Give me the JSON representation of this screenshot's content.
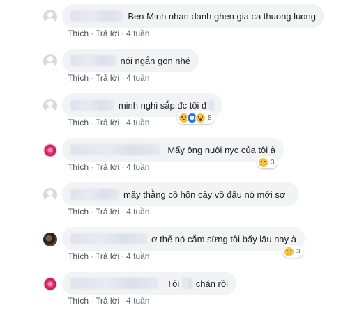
{
  "actions": {
    "like": "Thích",
    "reply": "Trả lời",
    "separator": "·"
  },
  "comments": [
    {
      "text": "Ben Minh nhan danh ghen gia ca thuong luong",
      "time": "4 tuần",
      "avatar": "default-avatar-icon"
    },
    {
      "text": "nói ngắn gọn nhé",
      "time": "4 tuần",
      "avatar": "default-avatar-icon"
    },
    {
      "text": "minh nghi sắp đc tôi đ",
      "time": "4 tuần",
      "avatar": "default-avatar-icon",
      "reactions": {
        "icons": [
          "sad",
          "like",
          "wow"
        ],
        "count": "8"
      }
    },
    {
      "text": "Mấy ông nuôi nyc của tôi à",
      "time": "4 tuần",
      "avatar": "flower-avatar",
      "reactions": {
        "icons": [
          "sad"
        ],
        "count": "3"
      }
    },
    {
      "text": "mấy thằng cô hồn cây vô đầu nó mới sợ",
      "time": "4 tuần",
      "avatar": "default-avatar-icon"
    },
    {
      "text": "ơ thế nó cắm sừng tôi bấy lâu nay à",
      "time": "4 tuần",
      "avatar": "photo-avatar",
      "reactions": {
        "icons": [
          "sad"
        ],
        "count": "3"
      }
    },
    {
      "text": "Tôi",
      "text2": "chán rồi",
      "time": "4 tuần",
      "avatar": "flower-avatar"
    }
  ],
  "colors": {
    "bubble": "#f2f3f5",
    "text": "#1c1e21",
    "meta": "#606770",
    "like": "#1877f2",
    "sad": "#f7c244"
  }
}
